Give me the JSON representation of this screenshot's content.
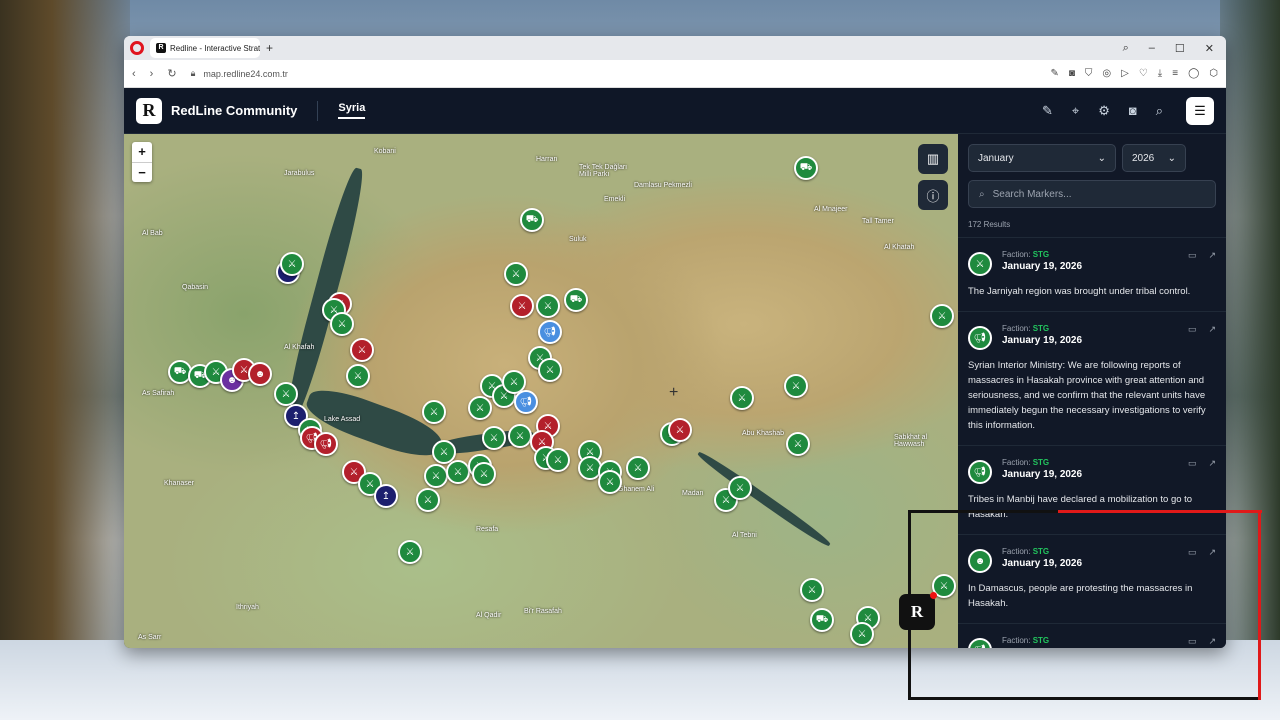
{
  "browser": {
    "tab_title": "Redline - Interactive Strate",
    "url": "map.redline24.com.tr"
  },
  "app": {
    "brand": "RedLine Community",
    "logo_letter": "R",
    "nav_active": "Syria"
  },
  "map": {
    "zoom_in": "+",
    "zoom_out": "−",
    "labels": [
      {
        "text": "Kobani"
      },
      {
        "text": "Jarabulus"
      },
      {
        "text": "Harran"
      },
      {
        "text": "Tek Tek Dağları Milli Parkı"
      },
      {
        "text": "Damlasu Pekmezli"
      },
      {
        "text": "Emekli"
      },
      {
        "text": "Suluk"
      },
      {
        "text": "Al Mnajeer"
      },
      {
        "text": "Tall Tamer"
      },
      {
        "text": "Al Khafah"
      },
      {
        "text": "As Safirah"
      },
      {
        "text": "Lake Assad"
      },
      {
        "text": "Khanaser"
      },
      {
        "text": "Resafa"
      },
      {
        "text": "Ithriyah"
      },
      {
        "text": "As Sarr"
      },
      {
        "text": "Bi'r Rasafah"
      },
      {
        "text": "Al Qadir"
      },
      {
        "text": "Ghanem Ali"
      },
      {
        "text": "Madan"
      },
      {
        "text": "Al Tebni"
      },
      {
        "text": "Abu Khashab"
      },
      {
        "text": "Sabkhat al Hawwash"
      },
      {
        "text": "Al Khatah"
      },
      {
        "text": "Al Bab"
      },
      {
        "text": "Qabasin"
      }
    ]
  },
  "panel": {
    "month": "January",
    "year": "2026",
    "search_placeholder": "Search Markers...",
    "results": "172 Results",
    "faction_prefix": "Faction:",
    "items": [
      {
        "faction": "STG",
        "date": "January 19, 2026",
        "text": "The Jarniyah region was brought under tribal control.",
        "icon": "rifle-icon"
      },
      {
        "faction": "STG",
        "date": "January 19, 2026",
        "text": "Syrian Interior Ministry: We are following reports of massacres in Hasakah province with great attention and seriousness, and we confirm that the relevant units have immediately begun the necessary investigations to verify this information.",
        "icon": "megaphone-icon"
      },
      {
        "faction": "STG",
        "date": "January 19, 2026",
        "text": "Tribes in Manbij have declared a mobilization to go to Hasakah.",
        "icon": "megaphone-icon"
      },
      {
        "faction": "STG",
        "date": "January 19, 2026",
        "text": "In Damascus, people are protesting the massacres in Hasakah.",
        "icon": "people-icon"
      },
      {
        "faction": "STG",
        "date": "",
        "text": "",
        "icon": "megaphone-icon"
      }
    ]
  },
  "colors": {
    "faction_green": "#22c55e",
    "marker_green": "#1f8a3e",
    "marker_red": "#b3202b",
    "marker_navy": "#1c1e6e"
  }
}
